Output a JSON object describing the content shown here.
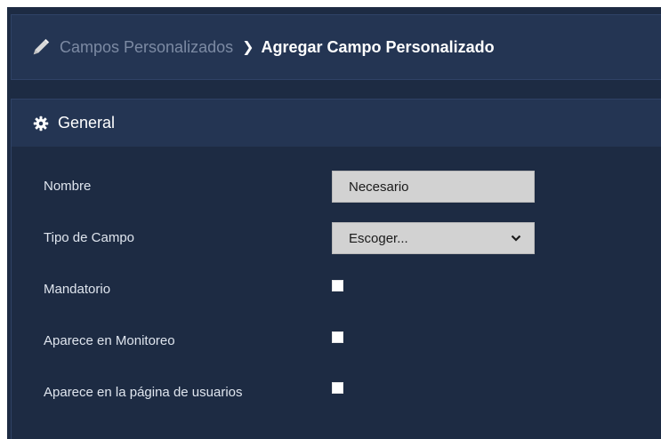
{
  "breadcrumb": {
    "parent": "Campos Personalizados",
    "separator": "❯",
    "current": "Agregar Campo Personalizado",
    "icon": "pencil-icon"
  },
  "card": {
    "title": "General",
    "icon": "gear-icon"
  },
  "form": {
    "nombre_label": "Nombre",
    "nombre_value": "Necesario",
    "tipo_label": "Tipo de Campo",
    "tipo_value": "Escoger...",
    "mandatorio_label": "Mandatorio",
    "monitoreo_label": "Aparece en Monitoreo",
    "usuarios_label": "Aparece en la página de usuarios"
  },
  "colors": {
    "background": "#1d2b43",
    "panel": "#243553",
    "muted_text": "#7c8aa3",
    "text": "#ffffff"
  }
}
